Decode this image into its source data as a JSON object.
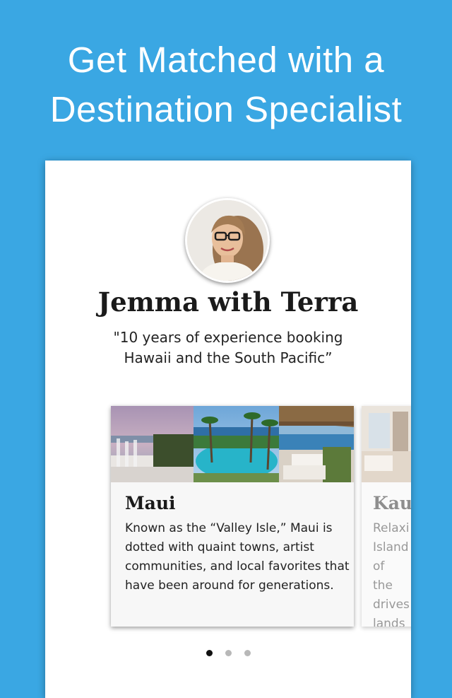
{
  "header": {
    "title_line1": "Get Matched with a",
    "title_line2": "Destination Specialist"
  },
  "specialist": {
    "name": "Jemma with Terra",
    "quote_line1": "\"10 years of experience booking",
    "quote_line2": "Hawaii and the South Pacific”"
  },
  "cards": [
    {
      "title": "Maui",
      "description": "Known as the “Valley Isle,” Maui is dotted with quaint towns, artist communities, and local favorites that have been around for generations."
    },
    {
      "title": "Kau",
      "description": "Relaxi Island of the drives lands"
    }
  ],
  "pager": {
    "count": 3,
    "active_index": 0
  },
  "colors": {
    "background": "#3aa7e3",
    "panel": "#ffffff",
    "card": "#f7f7f7",
    "dot_active": "#111111",
    "dot_inactive": "#b8b8b8"
  }
}
